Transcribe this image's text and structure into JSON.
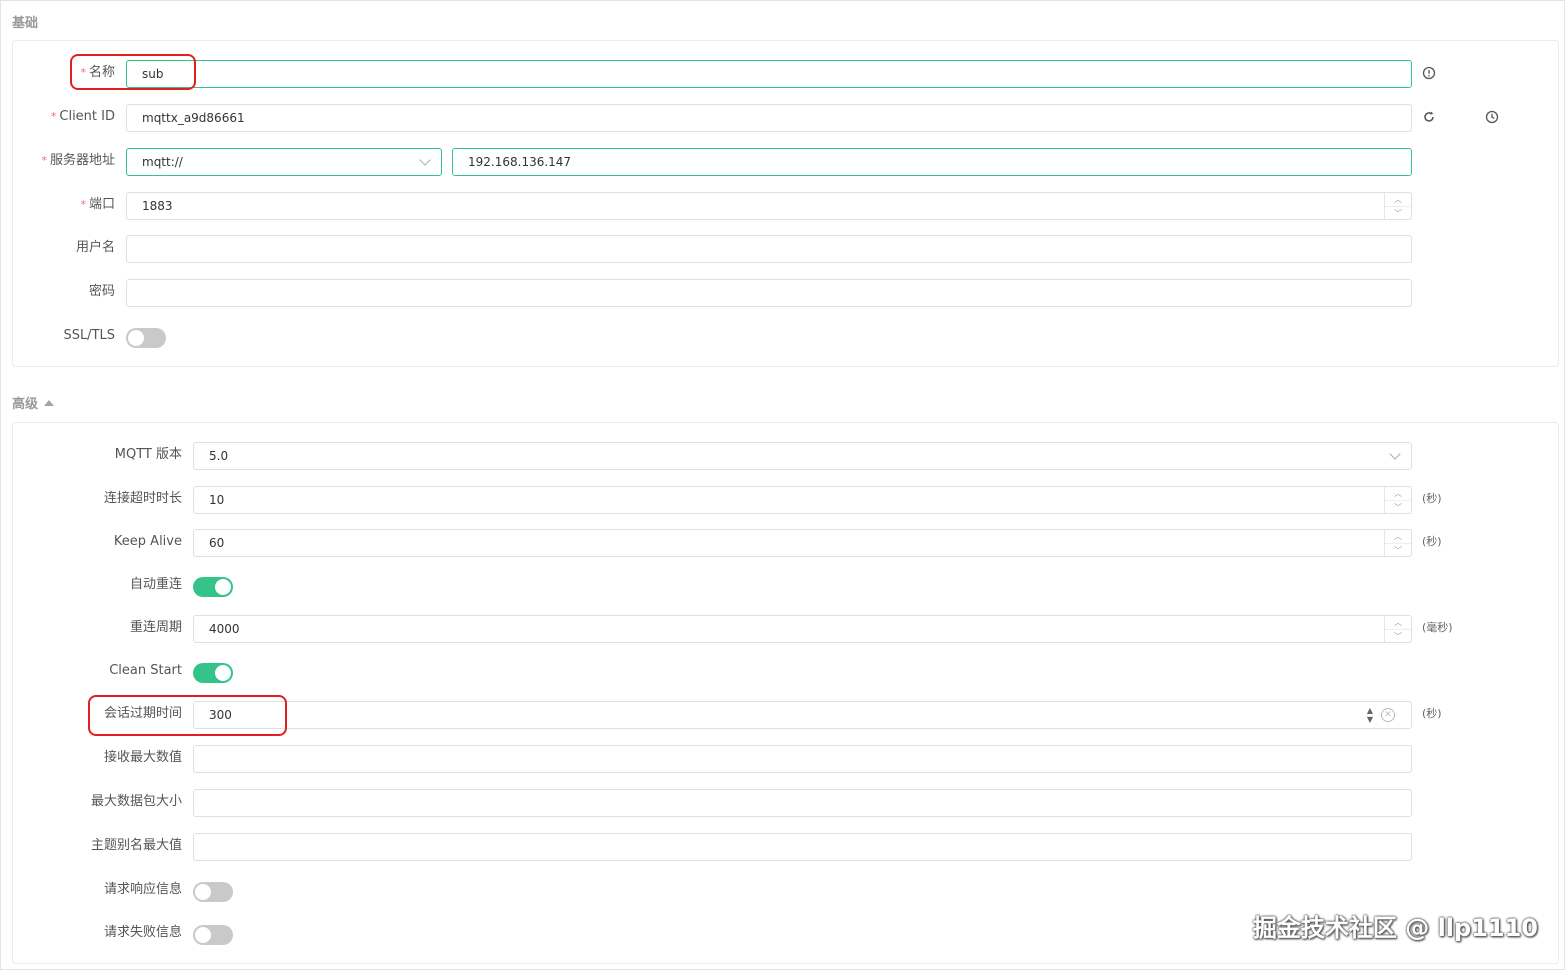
{
  "sections": {
    "basic_title": "基础",
    "advanced_title": "高级"
  },
  "basic": {
    "name": {
      "label": "名称",
      "required": "*",
      "value": "sub"
    },
    "client_id": {
      "label": "Client ID",
      "required": "*",
      "value": "mqttx_a9d86661"
    },
    "server": {
      "label": "服务器地址",
      "required": "*",
      "protocol": "mqtt://",
      "host": "192.168.136.147"
    },
    "port": {
      "label": "端口",
      "required": "*",
      "value": "1883"
    },
    "username": {
      "label": "用户名",
      "value": ""
    },
    "password": {
      "label": "密码",
      "value": ""
    },
    "ssl": {
      "label": "SSL/TLS",
      "on": false
    }
  },
  "advanced": {
    "mqtt_version": {
      "label": "MQTT 版本",
      "value": "5.0"
    },
    "connect_timeout": {
      "label": "连接超时时长",
      "value": "10",
      "unit": "(秒)"
    },
    "keep_alive": {
      "label": "Keep Alive",
      "value": "60",
      "unit": "(秒)"
    },
    "auto_reconnect": {
      "label": "自动重连",
      "on": true
    },
    "reconnect_period": {
      "label": "重连周期",
      "value": "4000",
      "unit": "(毫秒)"
    },
    "clean_start": {
      "label": "Clean Start",
      "on": true
    },
    "session_expiry": {
      "label": "会话过期时间",
      "value": "300",
      "unit": "(秒)"
    },
    "receive_max": {
      "label": "接收最大数值",
      "value": ""
    },
    "max_packet": {
      "label": "最大数据包大小",
      "value": ""
    },
    "topic_alias_max": {
      "label": "主题别名最大值",
      "value": ""
    },
    "request_response": {
      "label": "请求响应信息",
      "on": false
    },
    "request_problem": {
      "label": "请求失败信息",
      "on": false
    }
  },
  "icons": {
    "info": "info-icon",
    "refresh": "refresh-icon",
    "clock": "clock-icon"
  },
  "colors": {
    "accent": "#34c388",
    "highlight": "#e02020",
    "required": "#f56c6c"
  },
  "watermark": "掘金技术社区 @ llp1110"
}
